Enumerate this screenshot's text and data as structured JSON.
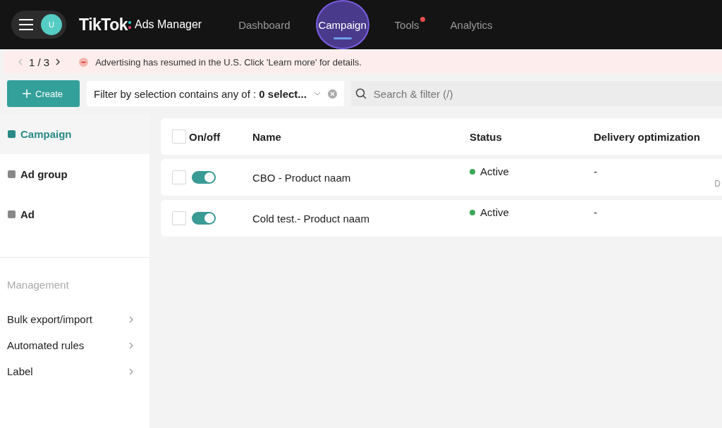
{
  "header": {
    "avatar": "U",
    "logo": "TikTok",
    "logo_suffix": "Ads Manager",
    "nav": [
      {
        "label": "Dashboard",
        "selected": false,
        "badge": false
      },
      {
        "label": "Campaign",
        "selected": true,
        "badge": false
      },
      {
        "label": "Tools",
        "selected": false,
        "badge": true
      },
      {
        "label": "Analytics",
        "selected": false,
        "badge": false
      }
    ]
  },
  "banner": {
    "pager": "1 / 3",
    "message": "Advertising has resumed in the U.S. Click 'Learn more' for details."
  },
  "toolbar": {
    "create": "Create",
    "filter": "Filter by selection contains any of : **0 select...**",
    "search": {
      "placeholder": "Search & filter (/)"
    }
  },
  "sidebar": {
    "levels": [
      {
        "label": "Campaign",
        "selected": true
      },
      {
        "label": "Ad group",
        "selected": false
      },
      {
        "label": "Ad",
        "selected": false
      }
    ],
    "section": "Management",
    "items": [
      {
        "label": "Bulk export/import"
      },
      {
        "label": "Automated rules"
      },
      {
        "label": "Label"
      }
    ]
  },
  "table": {
    "all_checked": false,
    "columns": [
      "On/off",
      "Name",
      "Status",
      "Delivery optimization"
    ],
    "rows": [
      {
        "checked": false,
        "on": true,
        "name": "CBO - Product naam",
        "status": "Active",
        "color": "#3aa856",
        "delivery": "-",
        "column_5": "D"
      },
      {
        "checked": false,
        "on": true,
        "name": "Cold test.- Product naam",
        "status": "Active",
        "color": "#3aa856",
        "delivery": "-"
      }
    ]
  }
}
